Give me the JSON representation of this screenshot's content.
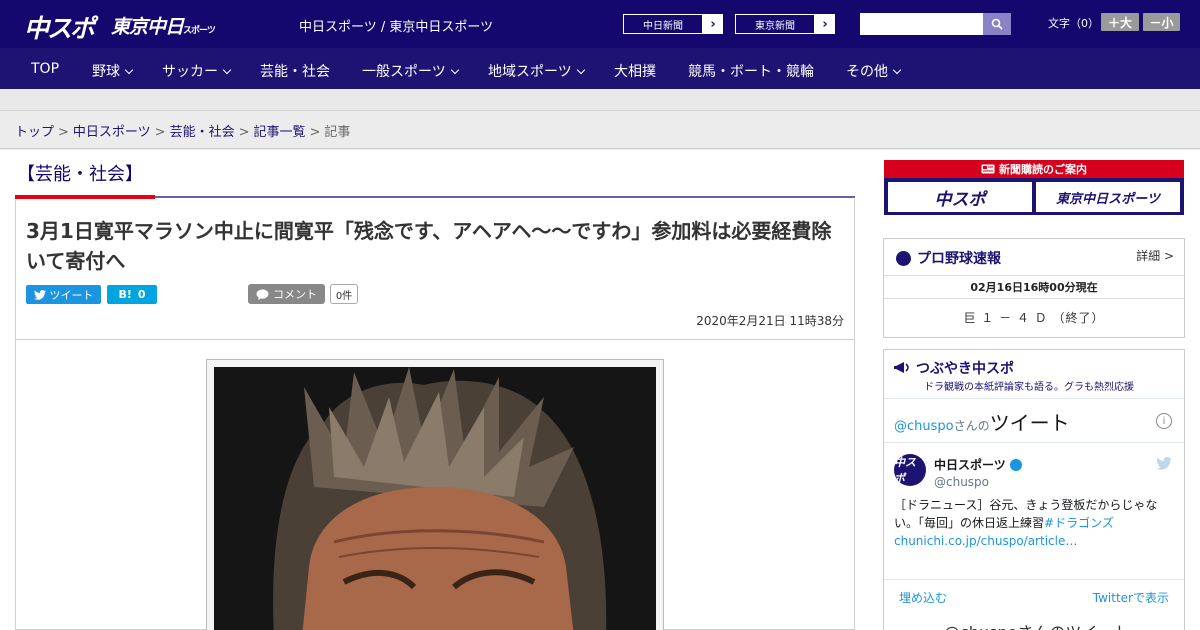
{
  "header": {
    "logo_main": "中スポ",
    "logo_sub": "東京中日",
    "logo_sub_small": "スポーツ",
    "site_title": "中日スポーツ / 東京中日スポーツ",
    "paper_links": [
      "中日新聞",
      "東京新聞"
    ],
    "search_placeholder": "",
    "font_size_label": "文字（0）",
    "font_bigger": "＋大",
    "font_smaller": "－小"
  },
  "nav": {
    "items": [
      {
        "label": "TOP",
        "dropdown": false
      },
      {
        "label": "野球",
        "dropdown": true
      },
      {
        "label": "サッカー",
        "dropdown": true
      },
      {
        "label": "芸能・社会",
        "dropdown": false
      },
      {
        "label": "一般スポーツ",
        "dropdown": true
      },
      {
        "label": "地域スポーツ",
        "dropdown": true
      },
      {
        "label": "大相撲",
        "dropdown": false
      },
      {
        "label": "競馬・ボート・競輪",
        "dropdown": false
      },
      {
        "label": "その他",
        "dropdown": true
      }
    ]
  },
  "breadcrumb": {
    "items": [
      "トップ",
      "中日スポーツ",
      "芸能・社会",
      "記事一覧"
    ],
    "current": "記事",
    "separator": ">"
  },
  "article": {
    "category": "【芸能・社会】",
    "headline": "3月1日寛平マラソン中止に間寛平「残念です、アヘアヘ～～ですわ」参加料は必要経費除いて寄付へ",
    "tweet_label": "ツイート",
    "hatena_label": "B!",
    "hatena_count": "0",
    "comment_label": "コメント",
    "comment_count": "0件",
    "date": "2020年2月21日 11時38分"
  },
  "sidebar": {
    "subscription_title": "新聞購読のご案内",
    "subscription_tiles": [
      "中スポ",
      "東京中日スポーツ"
    ],
    "score": {
      "title": "プロ野球速報",
      "detail_link": "詳細 >",
      "time": "02月16日16時00分現在",
      "line": "巨 １ － ４ Ｄ （終了）"
    },
    "twitter": {
      "title": "つぶやき中スポ",
      "subtitle": "ドラ観戦の本紙評論家も語る。グラも熱烈応援",
      "embed_handle": "@chuspo",
      "embed_san": "さんの",
      "embed_tweet": "ツイート",
      "avatar_text": "中スポ",
      "account_name": "中日スポーツ",
      "account_handle": "@chuspo",
      "tweet_text": "［ドラニュース］谷元、きょう登板だからじゃない。「毎回」の休日返上練習",
      "tweet_hashtag": "#ドラゴンズ",
      "tweet_link": "chunichi.co.jp/chuspo/article…",
      "embed_link": "埋め込む",
      "view_link": "Twitterで表示",
      "bottom_text": "@chuspoさんのツイート"
    }
  }
}
